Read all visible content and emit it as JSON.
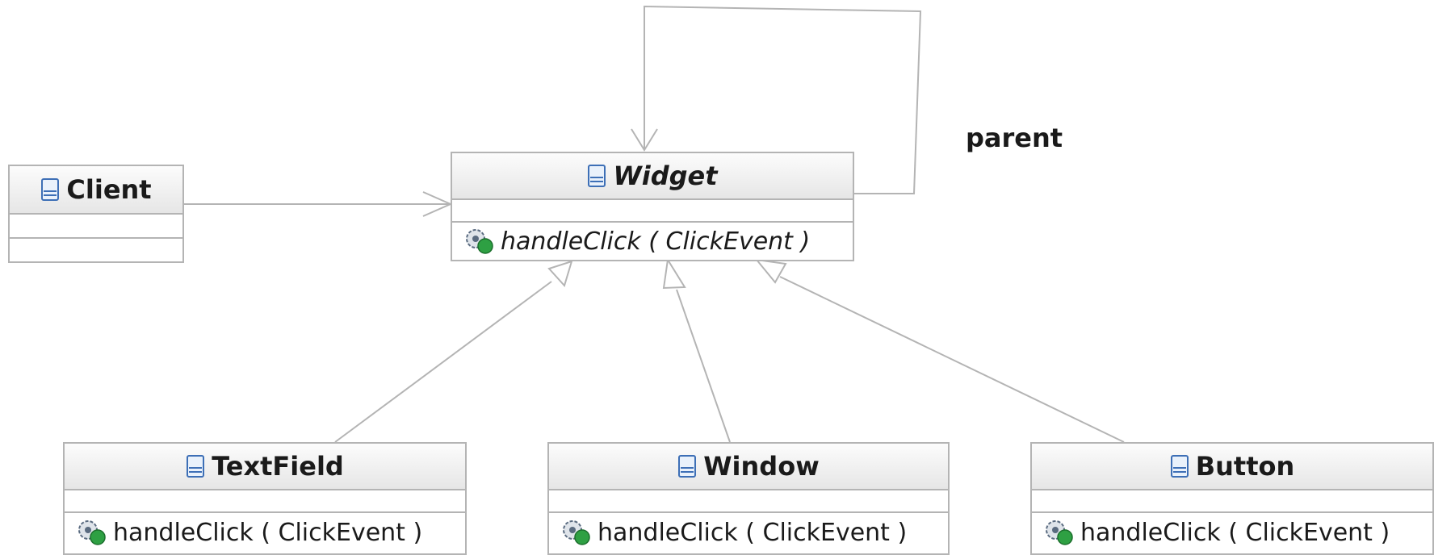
{
  "diagram": {
    "classes": [
      {
        "id": "client",
        "name": "Client",
        "italic": false,
        "operations": [],
        "icon": "class-icon"
      },
      {
        "id": "widget",
        "name": "Widget",
        "italic": true,
        "operations": [
          {
            "text": "handleClick ( ClickEvent )",
            "italic": true,
            "icon": "public-operation-icon"
          }
        ],
        "icon": "class-icon"
      },
      {
        "id": "textfield",
        "name": "TextField",
        "italic": false,
        "operations": [
          {
            "text": "handleClick ( ClickEvent )",
            "italic": false,
            "icon": "public-operation-icon"
          }
        ],
        "icon": "class-icon"
      },
      {
        "id": "window",
        "name": "Window",
        "italic": false,
        "operations": [
          {
            "text": "handleClick ( ClickEvent )",
            "italic": false,
            "icon": "public-operation-icon"
          }
        ],
        "icon": "class-icon"
      },
      {
        "id": "button",
        "name": "Button",
        "italic": false,
        "operations": [
          {
            "text": "handleClick ( ClickEvent )",
            "italic": false,
            "icon": "public-operation-icon"
          }
        ],
        "icon": "class-icon"
      }
    ],
    "relations": [
      {
        "type": "association",
        "from": "Client",
        "to": "Widget"
      },
      {
        "type": "association",
        "from": "Widget",
        "to": "Widget",
        "label": "parent"
      },
      {
        "type": "generalization",
        "from": "TextField",
        "to": "Widget"
      },
      {
        "type": "generalization",
        "from": "Window",
        "to": "Widget"
      },
      {
        "type": "generalization",
        "from": "Button",
        "to": "Widget"
      }
    ],
    "colors": {
      "border": "#b4b4b4",
      "icon_blue": "#3d6fb6",
      "icon_green": "#2ea043"
    }
  }
}
